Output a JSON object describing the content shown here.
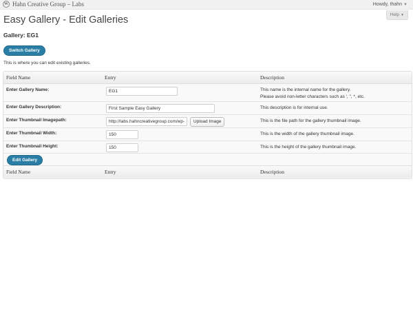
{
  "admin_bar": {
    "site_title": "Hahn Creative Group – Labs",
    "howdy": "Howdy, thahn"
  },
  "help_tab": "Help",
  "page": {
    "title": "Easy Gallery - Edit Galleries",
    "gallery_title": "Gallery: EG1",
    "switch_button": "Switch Gallery",
    "intro": "This is where you can edit existing galleries.",
    "edit_button": "Edit Gallery"
  },
  "table": {
    "headers": [
      "Field Name",
      "Entry",
      "Description"
    ],
    "rows": [
      {
        "label": "Enter Gallery Name:",
        "value": "EG1",
        "desc_lines": [
          "This name is the internal name for the gallery.",
          "Please avoid non-letter characters such as ', \", *, etc."
        ]
      },
      {
        "label": "Enter Gallery Description:",
        "value": "First Sample Easy Gallery",
        "desc_lines": [
          "This description is for internal use."
        ]
      },
      {
        "label": "Enter Thumbnail Imagepath:",
        "value": "http://labs.hahncreativegroup.com/wp-",
        "button": "Upload Image",
        "desc_lines": [
          "This is the file path for the gallery thumbnail image."
        ]
      },
      {
        "label": "Enter Thumbnail Width:",
        "value": "150",
        "desc_lines": [
          "This is the width of the gallery thumbnail image."
        ]
      },
      {
        "label": "Enter Thumbnail Height:",
        "value": "150",
        "desc_lines": [
          "This is the height of the gallery thumbnail image."
        ]
      }
    ]
  },
  "colors": {
    "primary_button": "#2a7ea6",
    "table_header_bg": "#ececec"
  }
}
